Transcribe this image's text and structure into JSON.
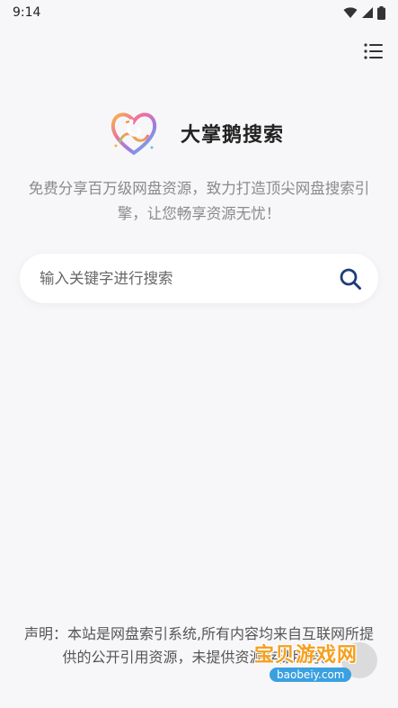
{
  "status": {
    "time": "9:14"
  },
  "brand": {
    "title": "大掌鹅搜索"
  },
  "tagline": "免费分享百万级网盘资源，致力打造顶尖网盘搜索引擎，让您畅享资源无忧！",
  "search": {
    "placeholder": "输入关键字进行搜索"
  },
  "disclaimer": "声明：本站是网盘索引系统,所有内容均来自互联网所提供的公开引用资源，未提供资源存储服务。",
  "watermark": {
    "text": "宝贝游戏网",
    "url": "baobeiy.com"
  },
  "colors": {
    "background": "#f7f7f9",
    "search_icon": "#1f3c78",
    "watermark": "#f5a020"
  },
  "icons": [
    "wifi-icon",
    "signal-icon",
    "battery-icon",
    "menu-icon",
    "swan-heart-logo",
    "search-icon"
  ]
}
